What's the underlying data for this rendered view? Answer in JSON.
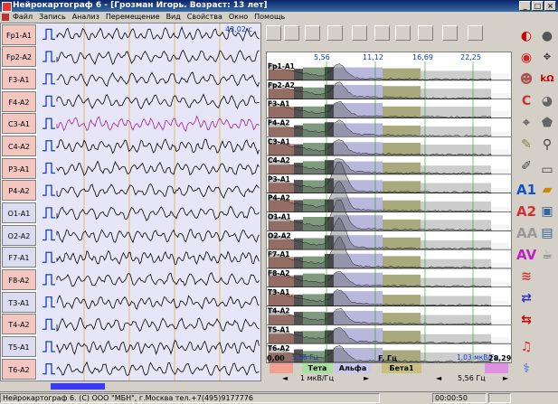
{
  "window": {
    "title": "Нейрокартограф 6 - [Грозман Игорь. Возраст: 13 лет]"
  },
  "menu": [
    "Файл",
    "Запись",
    "Анализ",
    "Перемещение",
    "Вид",
    "Свойства",
    "Окно",
    "Помощь"
  ],
  "eeg": {
    "time_marker": "43,02 с",
    "channels": [
      {
        "label": "Fp1-A1",
        "bg": "#f4c6c0"
      },
      {
        "label": "Fp2-A2",
        "bg": "#f4c6c0"
      },
      {
        "label": "F3-A1",
        "bg": "#f4c6c0"
      },
      {
        "label": "F4-A2",
        "bg": "#f4c6c0"
      },
      {
        "label": "C3-A1",
        "bg": "#f4c6c0"
      },
      {
        "label": "C4-A2",
        "bg": "#f4c6c0"
      },
      {
        "label": "P3-A1",
        "bg": "#f4c6c0"
      },
      {
        "label": "P4-A2",
        "bg": "#f4c6c0"
      },
      {
        "label": "O1-A1",
        "bg": "#dcdcf0"
      },
      {
        "label": "O2-A2",
        "bg": "#dcdcf0"
      },
      {
        "label": "F7-A1",
        "bg": "#dcdcf0"
      },
      {
        "label": "F8-A2",
        "bg": "#f4c6c0"
      },
      {
        "label": "T3-A1",
        "bg": "#dcdcf0"
      },
      {
        "label": "T4-A2",
        "bg": "#f4c6c0"
      },
      {
        "label": "T5-A1",
        "bg": "#dcdcf0"
      },
      {
        "label": "T6-A2",
        "bg": "#f4c6c0"
      }
    ]
  },
  "spectrum": {
    "freq_ticks": [
      "5,56",
      "11,12",
      "16,69",
      "22,25"
    ],
    "start_value": "0,00",
    "end_value": "28,29",
    "axis_label": "F, Гц",
    "bottom_left_label": "5,56 Гц",
    "bottom_right_label": "1,03 мкВ/Гц",
    "scale_left": "1 мкВ/Гц",
    "scale_right": "5,56 Гц",
    "bands": [
      {
        "label": "",
        "color": "#f4a090"
      },
      {
        "label": "Тета",
        "color": "#a8e0a0"
      },
      {
        "label": "Альфа",
        "color": "#c8c8f0"
      },
      {
        "label": "Бета1",
        "color": "#c8c080"
      },
      {
        "label": "",
        "color": "#e090e0"
      }
    ]
  },
  "right_toolbar": {
    "a1": "A1",
    "a2": "A2",
    "aa": "AA",
    "av": "AV"
  },
  "status": {
    "text": "Нейрокартограф 6. (С) ООО \"МБН\", г.Москва тел.+7(495)9177776",
    "time": "00:00:50"
  }
}
